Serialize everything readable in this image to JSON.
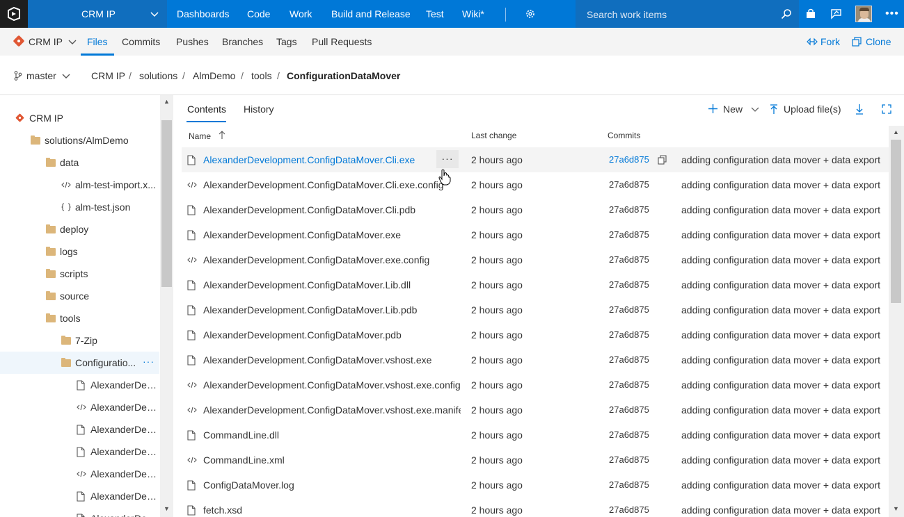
{
  "topbar": {
    "project": "CRM IP",
    "nav": [
      "Dashboards",
      "Code",
      "Work",
      "Build and Release",
      "Test",
      "Wiki*"
    ],
    "search_placeholder": "Search work items",
    "brand_color": "#0078d7"
  },
  "subnav": {
    "repo": "CRM IP",
    "tabs": [
      "Files",
      "Commits",
      "Pushes",
      "Branches",
      "Tags",
      "Pull Requests"
    ],
    "fork": "Fork",
    "clone": "Clone"
  },
  "breadcrumb": {
    "branch": "master",
    "parts": [
      "CRM IP",
      "solutions",
      "AlmDemo",
      "tools",
      "ConfigurationDataMover"
    ]
  },
  "tree": {
    "items": [
      {
        "label": "CRM IP",
        "icon": "git-repo-icon"
      },
      {
        "label": "solutions/AlmDemo",
        "icon": "folder-icon"
      },
      {
        "label": "data",
        "icon": "folder-icon"
      },
      {
        "label": "alm-test-import.x...",
        "icon": "code-file-icon"
      },
      {
        "label": "alm-test.json",
        "icon": "json-file-icon"
      },
      {
        "label": "deploy",
        "icon": "folder-icon"
      },
      {
        "label": "logs",
        "icon": "folder-icon"
      },
      {
        "label": "scripts",
        "icon": "folder-icon"
      },
      {
        "label": "source",
        "icon": "folder-icon"
      },
      {
        "label": "tools",
        "icon": "folder-icon"
      },
      {
        "label": "7-Zip",
        "icon": "folder-icon"
      },
      {
        "label": "Configuratio...",
        "icon": "folder-icon"
      },
      {
        "label": "AlexanderDev...",
        "icon": "file-icon"
      },
      {
        "label": "AlexanderDev...",
        "icon": "code-file-icon"
      },
      {
        "label": "AlexanderDev...",
        "icon": "file-icon"
      },
      {
        "label": "AlexanderDev...",
        "icon": "file-icon"
      },
      {
        "label": "AlexanderDev...",
        "icon": "code-file-icon"
      },
      {
        "label": "AlexanderDev...",
        "icon": "file-icon"
      },
      {
        "label": "AlexanderDev...",
        "icon": "file-icon"
      }
    ]
  },
  "main": {
    "tabs": [
      "Contents",
      "History"
    ],
    "toolbar": {
      "new": "New",
      "upload": "Upload file(s)"
    },
    "columns": {
      "name": "Name",
      "last_change": "Last change",
      "commits": "Commits"
    },
    "rows": [
      {
        "name": "AlexanderDevelopment.ConfigDataMover.Cli.exe",
        "icon": "file-icon",
        "time": "2 hours ago",
        "commit": "27a6d875",
        "message": "adding configuration data mover + data export"
      },
      {
        "name": "AlexanderDevelopment.ConfigDataMover.Cli.exe.config",
        "icon": "code-file-icon",
        "time": "2 hours ago",
        "commit": "27a6d875",
        "message": "adding configuration data mover + data export"
      },
      {
        "name": "AlexanderDevelopment.ConfigDataMover.Cli.pdb",
        "icon": "file-icon",
        "time": "2 hours ago",
        "commit": "27a6d875",
        "message": "adding configuration data mover + data export"
      },
      {
        "name": "AlexanderDevelopment.ConfigDataMover.exe",
        "icon": "file-icon",
        "time": "2 hours ago",
        "commit": "27a6d875",
        "message": "adding configuration data mover + data export"
      },
      {
        "name": "AlexanderDevelopment.ConfigDataMover.exe.config",
        "icon": "code-file-icon",
        "time": "2 hours ago",
        "commit": "27a6d875",
        "message": "adding configuration data mover + data export"
      },
      {
        "name": "AlexanderDevelopment.ConfigDataMover.Lib.dll",
        "icon": "file-icon",
        "time": "2 hours ago",
        "commit": "27a6d875",
        "message": "adding configuration data mover + data export"
      },
      {
        "name": "AlexanderDevelopment.ConfigDataMover.Lib.pdb",
        "icon": "file-icon",
        "time": "2 hours ago",
        "commit": "27a6d875",
        "message": "adding configuration data mover + data export"
      },
      {
        "name": "AlexanderDevelopment.ConfigDataMover.pdb",
        "icon": "file-icon",
        "time": "2 hours ago",
        "commit": "27a6d875",
        "message": "adding configuration data mover + data export"
      },
      {
        "name": "AlexanderDevelopment.ConfigDataMover.vshost.exe",
        "icon": "file-icon",
        "time": "2 hours ago",
        "commit": "27a6d875",
        "message": "adding configuration data mover + data export"
      },
      {
        "name": "AlexanderDevelopment.ConfigDataMover.vshost.exe.config",
        "icon": "code-file-icon",
        "time": "2 hours ago",
        "commit": "27a6d875",
        "message": "adding configuration data mover + data export"
      },
      {
        "name": "AlexanderDevelopment.ConfigDataMover.vshost.exe.manifest",
        "icon": "code-file-icon",
        "time": "2 hours ago",
        "commit": "27a6d875",
        "message": "adding configuration data mover + data export"
      },
      {
        "name": "CommandLine.dll",
        "icon": "file-icon",
        "time": "2 hours ago",
        "commit": "27a6d875",
        "message": "adding configuration data mover + data export"
      },
      {
        "name": "CommandLine.xml",
        "icon": "code-file-icon",
        "time": "2 hours ago",
        "commit": "27a6d875",
        "message": "adding configuration data mover + data export"
      },
      {
        "name": "ConfigDataMover.log",
        "icon": "file-icon",
        "time": "2 hours ago",
        "commit": "27a6d875",
        "message": "adding configuration data mover + data export"
      },
      {
        "name": "fetch.xsd",
        "icon": "file-icon",
        "time": "2 hours ago",
        "commit": "27a6d875",
        "message": "adding configuration data mover + data export"
      }
    ]
  }
}
